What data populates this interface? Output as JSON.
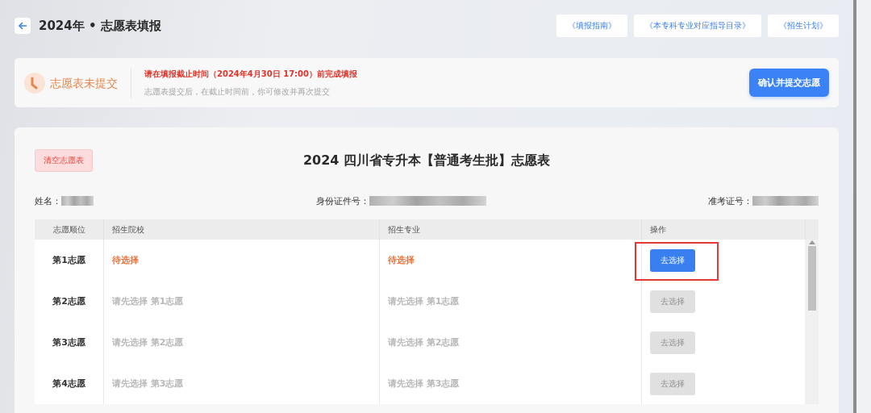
{
  "header": {
    "title": "2024年 • 志愿表填报"
  },
  "links": [
    "《填报指南》",
    "《本专科专业对应指导目录》",
    "《招生计划》"
  ],
  "status": {
    "label": "志愿表未提交",
    "deadline": "请在填报截止时间（2024年4月30日 17:00）前完成填报",
    "note": "志愿表提交后，在截止时间前，你可修改并再次提交",
    "submit": "确认并提交志愿"
  },
  "form": {
    "title": "2024 四川省专升本【普通考生批】志愿表",
    "clear": "清空志愿表",
    "fields": [
      {
        "label": "姓名："
      },
      {
        "label": "身份证件号："
      },
      {
        "label": "准考证号："
      }
    ],
    "columns": [
      "志愿顺位",
      "招生院校",
      "招生专业",
      "操作"
    ],
    "rows": [
      {
        "rank": "第1志愿",
        "school": "待选择",
        "major": "待选择",
        "kind": "pending",
        "action": "去选择",
        "disabled": false,
        "highlighted": true
      },
      {
        "rank": "第2志愿",
        "school": "请先选择 第1志愿",
        "major": "请先选择 第1志愿",
        "kind": "locked",
        "action": "去选择",
        "disabled": true,
        "highlighted": false
      },
      {
        "rank": "第3志愿",
        "school": "请先选择 第2志愿",
        "major": "请先选择 第2志愿",
        "kind": "locked",
        "action": "去选择",
        "disabled": true,
        "highlighted": false
      },
      {
        "rank": "第4志愿",
        "school": "请先选择 第3志愿",
        "major": "请先选择 第3志愿",
        "kind": "locked",
        "action": "去选择",
        "disabled": true,
        "highlighted": false
      }
    ]
  }
}
